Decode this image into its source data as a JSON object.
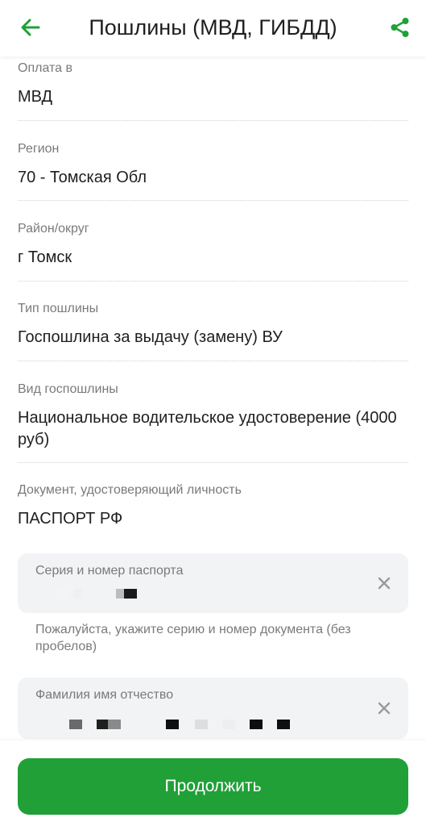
{
  "header": {
    "title": "Пошлины (МВД, ГИБДД)",
    "back_icon": "arrow-left-icon",
    "share_icon": "share-icon",
    "accent_color": "#21a038"
  },
  "fields": [
    {
      "label": "Оплата в",
      "value": "МВД"
    },
    {
      "label": "Регион",
      "value": "70 - Томская Обл"
    },
    {
      "label": "Район/округ",
      "value": "г Томск"
    },
    {
      "label": "Тип пошлины",
      "value": "Госпошлина за выдачу (замену) ВУ"
    },
    {
      "label": "Вид госпошлины",
      "value": "Национальное водительское удостоверение (4000 руб)"
    },
    {
      "label": "Документ, удостоверяющий личность",
      "value": "ПАСПОРТ РФ"
    }
  ],
  "passport_input": {
    "label": "Серия и номер паспорта",
    "hint": "Пожалуйста, укажите серию и номер документа (без пробелов)",
    "clear_icon": "close-icon"
  },
  "fio_input": {
    "label": "Фамилия имя отчество",
    "clear_icon": "close-icon"
  },
  "footer": {
    "continue_label": "Продолжить",
    "button_color": "#21a038"
  }
}
